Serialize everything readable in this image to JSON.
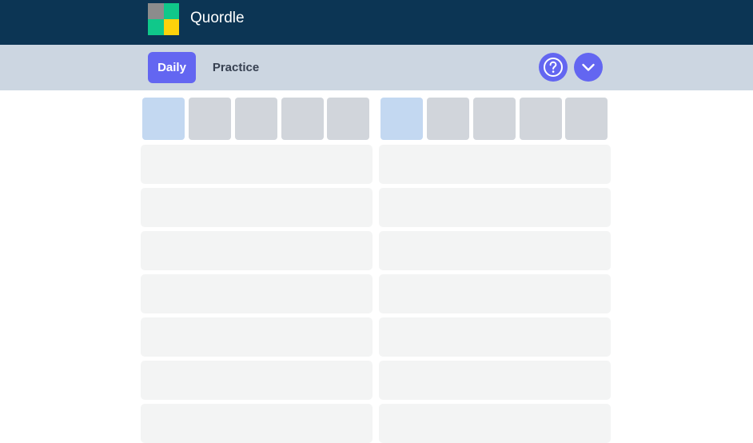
{
  "header": {
    "title": "Quordle",
    "logo_colors": [
      "#8c8c8c",
      "#10c88a",
      "#10c88a",
      "#fdd20b"
    ],
    "background": "#0c3554"
  },
  "nav": {
    "daily_label": "Daily",
    "practice_label": "Practice",
    "help_icon": "question-circle-icon",
    "dropdown_icon": "chevron-down-icon",
    "accent": "#6366f1"
  },
  "boards": [
    {
      "tiles": 5,
      "active_tile": 0,
      "visible_rows": 7
    },
    {
      "tiles": 5,
      "active_tile": 0,
      "visible_rows": 7
    }
  ],
  "colors": {
    "tile_empty": "#d1d5db",
    "tile_active": "#c3d8f1",
    "row_empty": "#f3f4f4"
  }
}
